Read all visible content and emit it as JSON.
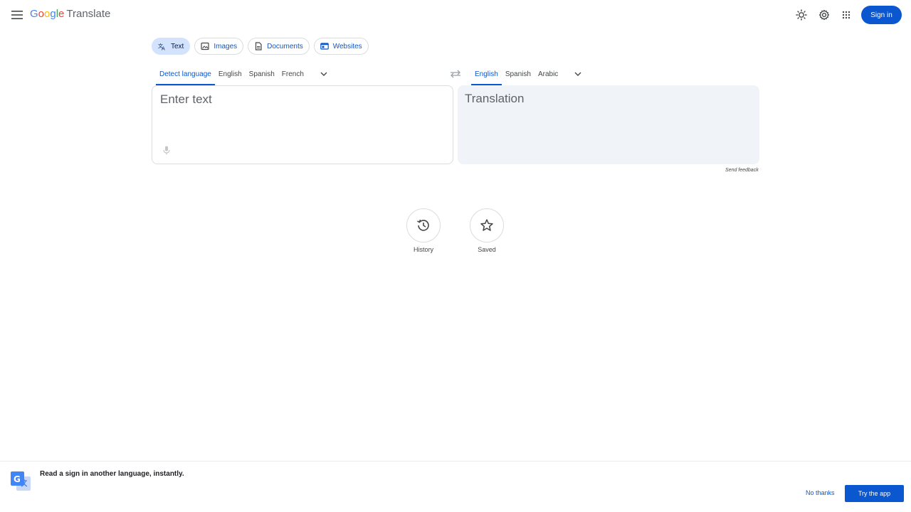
{
  "header": {
    "logo_google": "Google",
    "logo_product": "Translate",
    "signin_label": "Sign in"
  },
  "modes": [
    {
      "label": "Text",
      "icon": "translate-icon"
    },
    {
      "label": "Images",
      "icon": "image-icon"
    },
    {
      "label": "Documents",
      "icon": "document-icon"
    },
    {
      "label": "Websites",
      "icon": "website-icon"
    }
  ],
  "source_languages": [
    "Detect language",
    "English",
    "Spanish",
    "French"
  ],
  "target_languages": [
    "English",
    "Spanish",
    "Arabic"
  ],
  "source_box": {
    "placeholder": "Enter text"
  },
  "target_box": {
    "placeholder": "Translation"
  },
  "feedback_label": "Send feedback",
  "history_label": "History",
  "saved_label": "Saved",
  "banner": {
    "text": "Read a sign in another language, instantly.",
    "no_thanks": "No thanks",
    "try_app": "Try the app"
  },
  "colors": {
    "accent": "#0b57d0",
    "active_tab_bg": "#d3e3fd",
    "translation_bg": "#f0f4f9"
  }
}
